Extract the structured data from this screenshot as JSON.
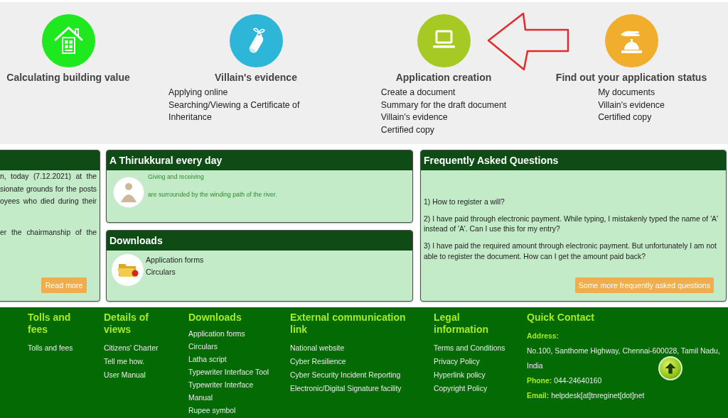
{
  "services": [
    {
      "title": "Calculating building value",
      "color": "#1fe81f",
      "marked": false
    },
    {
      "title": "Villain's evidence",
      "color": "#2db6d8",
      "marked": false,
      "links": [
        "Applying online",
        "Searching/Viewing a Certificate of Inheritance"
      ]
    },
    {
      "title": "Application creation",
      "color": "#a6c923",
      "marked": true,
      "links": [
        "Create a document",
        "Summary for the draft document",
        "Villain's evidence",
        "Certified copy"
      ]
    },
    {
      "title": "Find out your application status",
      "color": "#f0ae2c",
      "marked": false,
      "links": [
        "My documents",
        "Villain's evidence",
        "Certified copy"
      ]
    }
  ],
  "news_panel": {
    "paragraphs": [
      [
        "n, today (7.12.2021) at the",
        "sionate grounds for the posts",
        "oyees who died during their"
      ],
      [
        "er the chairmanship of the"
      ]
    ],
    "button": "Read more"
  },
  "thirukkural_panel": {
    "title": "A Thirukkural every day",
    "lines": [
      "Giving and receiving",
      "are surrounded by the winding path of the river."
    ]
  },
  "downloads_panel": {
    "title": "Downloads",
    "links": [
      "Application forms",
      "Circulars"
    ]
  },
  "faq_panel": {
    "title": "Frequently Asked Questions",
    "questions": [
      "1) How to register a will?",
      "2) I have paid through electronic payment. While typing, I mistakenly typed the name of 'A' instead of 'A'. Can I use this for my entry?",
      "3) I have paid the required amount through electronic payment. But unfortunately I am not able to register the document. How can I get the amount paid back?"
    ],
    "button": "Some more frequently asked questions"
  },
  "footer": {
    "columns": [
      {
        "heading": "Tolls and fees",
        "links": [
          "Tolls and fees"
        ]
      },
      {
        "heading": "Details of views",
        "links": [
          "Citizens' Charter",
          "Tell me how.",
          "User Manual"
        ]
      },
      {
        "heading": "Downloads",
        "links": [
          "Application forms",
          "Circulars",
          "Latha script",
          "Typewriter Interface Tool",
          "Typewriter Interface Manual",
          "Rupee symbol"
        ]
      },
      {
        "heading": "External communication link",
        "links": [
          "National website",
          "Cyber Resilience",
          "Cyber Security Incident Reporting",
          "Electronic/Digital Signature facility"
        ]
      },
      {
        "heading": "Legal information",
        "links": [
          "Terms and Conditions",
          "Privacy Policy",
          "Hyperlink policy",
          "Copyright Policy"
        ]
      }
    ],
    "contact": {
      "heading": "Quick Contact",
      "address_label": "Address:",
      "address_lines": [
        "No.100, Santhome Highway, Chennai-600028, Tamil Nadu,",
        "India"
      ],
      "phone_label": "Phone:",
      "phone": "044-24640160",
      "email_label": "Email:",
      "email": "helpdesk[at]tnreginet[dot]net"
    }
  }
}
